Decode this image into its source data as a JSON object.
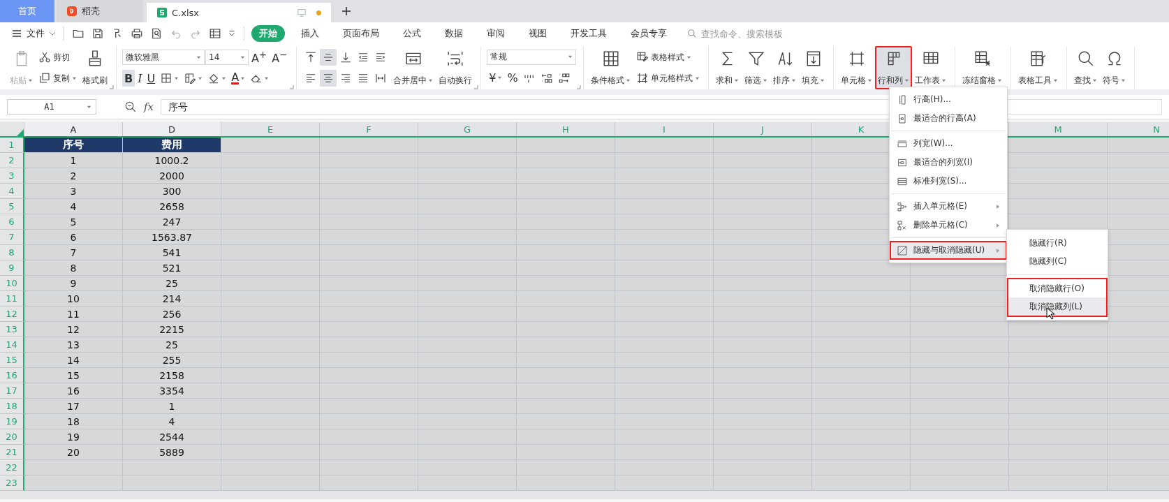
{
  "tabs": [
    {
      "label": "首页",
      "kind": "home",
      "selected": false
    },
    {
      "label": "稻壳",
      "kind": "docer",
      "selected": false
    },
    {
      "label": "C.xlsx",
      "kind": "sheet",
      "selected": true,
      "modified": true
    }
  ],
  "menu_bar": {
    "file": "文件",
    "tabs": [
      {
        "label": "开始",
        "selected": true
      },
      {
        "label": "插入",
        "selected": false
      },
      {
        "label": "页面布局",
        "selected": false
      },
      {
        "label": "公式",
        "selected": false
      },
      {
        "label": "数据",
        "selected": false
      },
      {
        "label": "审阅",
        "selected": false
      },
      {
        "label": "视图",
        "selected": false
      },
      {
        "label": "开发工具",
        "selected": false
      },
      {
        "label": "会员专享",
        "selected": false
      }
    ],
    "search": {
      "placeholder": "查找命令、搜索模板"
    }
  },
  "ribbon": {
    "groups": [
      {
        "launcher": true,
        "blocks": [
          {
            "kind": "large",
            "label": "粘贴",
            "dropdown": true,
            "disabled": true
          },
          {
            "kind": "stack",
            "lines": [
              {
                "controls": [
                  {
                    "kind": "small",
                    "label": "剪切",
                    "dropdown": false
                  }
                ]
              },
              {
                "controls": [
                  {
                    "kind": "small",
                    "label": "复制",
                    "dropdown": true
                  }
                ]
              }
            ]
          },
          {
            "kind": "large",
            "label": "格式刷",
            "dropdown": false
          }
        ]
      },
      {
        "launcher": true,
        "blocks": [
          {
            "kind": "stack",
            "lines": [
              {
                "controls": [
                  {
                    "kind": "select",
                    "value": "微软雅黑"
                  },
                  {
                    "kind": "select",
                    "value": "14"
                  },
                  {
                    "kind": "glyph",
                    "text": "A$^{+}$",
                    "dropdown": false
                  },
                  {
                    "kind": "glyph",
                    "text": "A$^{−}$",
                    "dropdown": false
                  }
                ]
              },
              {
                "controls": [
                  {
                    "kind": "glyph",
                    "text": "B",
                    "selected": true,
                    "dropdown": false
                  },
                  {
                    "kind": "glyph",
                    "text": "I",
                    "selected": false,
                    "dropdown": false
                  },
                  {
                    "kind": "glyph",
                    "text": "U",
                    "selected": false,
                    "dropdown": false
                  },
                  {
                    "kind": "icon",
                    "dropdown": true
                  },
                  {
                    "kind": "icon",
                    "dropdown": true
                  },
                  {
                    "kind": "icon",
                    "dropdown": true
                  },
                  {
                    "kind": "glyph",
                    "text": "A",
                    "selected": false,
                    "dropdown": true
                  },
                  {
                    "kind": "icon",
                    "dropdown": true
                  }
                ]
              }
            ]
          }
        ]
      },
      {
        "launcher": true,
        "blocks": [
          {
            "kind": "stack",
            "lines": [
              {
                "controls": [
                  {
                    "kind": "icon",
                    "selected": false
                  },
                  {
                    "kind": "icon",
                    "selected": true
                  },
                  {
                    "kind": "icon",
                    "selected": false
                  },
                  {
                    "kind": "icon",
                    "selected": false
                  },
                  {
                    "kind": "icon",
                    "selected": false
                  }
                ]
              },
              {
                "controls": [
                  {
                    "kind": "icon",
                    "selected": false
                  },
                  {
                    "kind": "icon",
                    "selected": true
                  },
                  {
                    "kind": "icon",
                    "selected": false
                  },
                  {
                    "kind": "icon",
                    "selected": false
                  },
                  {
                    "kind": "icon",
                    "selected": false
                  }
                ]
              }
            ]
          },
          {
            "kind": "large",
            "label": "合并居中",
            "dropdown": true
          },
          {
            "kind": "large",
            "label": "自动换行",
            "dropdown": false
          }
        ]
      },
      {
        "launcher": true,
        "blocks": [
          {
            "kind": "stack",
            "lines": [
              {
                "controls": [
                  {
                    "kind": "select",
                    "value": "常规"
                  }
                ]
              },
              {
                "controls": [
                  {
                    "kind": "glyph",
                    "text": "¥",
                    "dropdown": true
                  },
                  {
                    "kind": "glyph",
                    "text": "%",
                    "dropdown": false
                  },
                  {
                    "kind": "icon",
                    "dropdown": false
                  },
                  {
                    "kind": "icon",
                    "dropdown": false
                  },
                  {
                    "kind": "icon",
                    "dropdown": false
                  }
                ]
              }
            ]
          }
        ]
      },
      {
        "blocks": [
          {
            "kind": "large",
            "label": "条件格式",
            "dropdown": true
          },
          {
            "kind": "stack",
            "lines": [
              {
                "controls": [
                  {
                    "kind": "small",
                    "label": "表格样式",
                    "dropdown": true
                  }
                ]
              },
              {
                "controls": [
                  {
                    "kind": "small",
                    "label": "单元格样式",
                    "dropdown": true
                  }
                ]
              }
            ]
          }
        ]
      },
      {
        "blocks": [
          {
            "kind": "large",
            "label": "求和",
            "dropdown": true
          },
          {
            "kind": "large",
            "label": "筛选",
            "dropdown": true
          },
          {
            "kind": "large",
            "label": "排序",
            "dropdown": true
          },
          {
            "kind": "large",
            "label": "填充",
            "dropdown": true
          }
        ]
      },
      {
        "blocks": [
          {
            "kind": "large",
            "label": "单元格",
            "dropdown": true
          },
          {
            "kind": "large",
            "label": "行和列",
            "dropdown": true,
            "selected": true,
            "highlighted": true
          },
          {
            "kind": "large",
            "label": "工作表",
            "dropdown": true
          }
        ]
      },
      {
        "blocks": [
          {
            "kind": "large",
            "label": "冻结窗格",
            "dropdown": true
          }
        ]
      },
      {
        "blocks": [
          {
            "kind": "large",
            "label": "表格工具",
            "dropdown": true
          }
        ]
      },
      {
        "blocks": [
          {
            "kind": "large",
            "label": "查找",
            "dropdown": true
          },
          {
            "kind": "large",
            "label": "符号",
            "dropdown": true
          }
        ]
      }
    ]
  },
  "formula_bar": {
    "name_box": "A1",
    "fx": "fx",
    "value": "序号"
  },
  "sheet": {
    "columns": [
      {
        "label": "A",
        "selected": false
      },
      {
        "label": "D",
        "selected": false
      },
      {
        "label": "E",
        "selected": true
      },
      {
        "label": "F",
        "selected": true
      },
      {
        "label": "G",
        "selected": true
      },
      {
        "label": "H",
        "selected": true
      },
      {
        "label": "I",
        "selected": true
      },
      {
        "label": "J",
        "selected": true
      },
      {
        "label": "K",
        "selected": true
      },
      {},
      {
        "label": "M",
        "selected": true
      },
      {
        "label": "N",
        "selected": true
      }
    ],
    "rows": [
      {
        "number": "1",
        "kind": "header",
        "cells": [
          "序号",
          "费用"
        ]
      },
      {
        "number": "2",
        "kind": "data",
        "cells": [
          "1",
          "1000.2"
        ]
      },
      {
        "number": "3",
        "kind": "data",
        "cells": [
          "2",
          "2000"
        ]
      },
      {
        "number": "4",
        "kind": "data",
        "cells": [
          "3",
          "300"
        ]
      },
      {
        "number": "5",
        "kind": "data",
        "cells": [
          "4",
          "2658"
        ]
      },
      {
        "number": "6",
        "kind": "data",
        "cells": [
          "5",
          "247"
        ]
      },
      {
        "number": "7",
        "kind": "data",
        "cells": [
          "6",
          "1563.87"
        ]
      },
      {
        "number": "8",
        "kind": "data",
        "cells": [
          "7",
          "541"
        ]
      },
      {
        "number": "9",
        "kind": "data",
        "cells": [
          "8",
          "521"
        ]
      },
      {
        "number": "10",
        "kind": "data",
        "cells": [
          "9",
          "25"
        ]
      },
      {
        "number": "11",
        "kind": "data",
        "cells": [
          "10",
          "214"
        ]
      },
      {
        "number": "12",
        "kind": "data",
        "cells": [
          "11",
          "256"
        ]
      },
      {
        "number": "13",
        "kind": "data",
        "cells": [
          "12",
          "2215"
        ]
      },
      {
        "number": "14",
        "kind": "data",
        "cells": [
          "13",
          "25"
        ]
      },
      {
        "number": "15",
        "kind": "data",
        "cells": [
          "14",
          "255"
        ]
      },
      {
        "number": "16",
        "kind": "data",
        "cells": [
          "15",
          "2158"
        ]
      },
      {
        "number": "17",
        "kind": "data",
        "cells": [
          "16",
          "3354"
        ]
      },
      {
        "number": "18",
        "kind": "data",
        "cells": [
          "17",
          "1"
        ]
      },
      {
        "number": "19",
        "kind": "data",
        "cells": [
          "18",
          "4"
        ]
      },
      {
        "number": "20",
        "kind": "data",
        "cells": [
          "19",
          "2544"
        ]
      },
      {
        "number": "21",
        "kind": "data",
        "cells": [
          "20",
          "5889"
        ]
      },
      {
        "number": "22"
      },
      {
        "number": "23"
      }
    ]
  },
  "menu": {
    "groups": [
      {
        "items": [
          {
            "label": "行高(H)...",
            "submenu": false,
            "selected": false,
            "highlighted": false
          },
          {
            "label": "最适合的行高(A)",
            "submenu": false,
            "selected": false,
            "highlighted": false
          }
        ]
      },
      {
        "items": [
          {
            "label": "列宽(W)...",
            "submenu": false,
            "selected": false,
            "highlighted": false
          },
          {
            "label": "最适合的列宽(I)",
            "submenu": false,
            "selected": false,
            "highlighted": false
          },
          {
            "label": "标准列宽(S)...",
            "submenu": false,
            "selected": false,
            "highlighted": false
          }
        ]
      },
      {
        "items": [
          {
            "label": "插入单元格(E)",
            "submenu": true,
            "selected": false,
            "highlighted": false
          },
          {
            "label": "删除单元格(C)",
            "submenu": true,
            "selected": false,
            "highlighted": false
          }
        ]
      },
      {
        "items": [
          {
            "label": "隐藏与取消隐藏(U)",
            "submenu": true,
            "selected": true,
            "highlighted": true
          }
        ]
      }
    ]
  },
  "submenu": {
    "groups": [
      {
        "highlighted": false,
        "items": [
          {
            "label": "隐藏行(R)",
            "selected": false
          },
          {
            "label": "隐藏列(C)",
            "selected": false
          }
        ]
      },
      {
        "highlighted": true,
        "items": [
          {
            "label": "取消隐藏行(O)",
            "selected": false
          },
          {
            "label": "取消隐藏列(L)",
            "selected": true
          }
        ]
      }
    ]
  }
}
